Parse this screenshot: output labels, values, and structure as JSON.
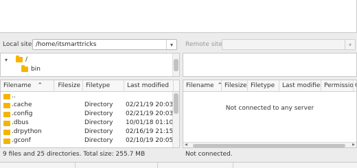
{
  "local": {
    "site_label": "Local site:",
    "path": "/home/itsmarttricks",
    "tree": [
      {
        "toggle": "▾",
        "label": "/"
      },
      {
        "toggle": "",
        "label": "bin"
      }
    ],
    "columns": [
      "Filename",
      "Filesize",
      "Filetype",
      "Last modified"
    ],
    "sort_indicator": "⌃",
    "rows": [
      {
        "name": "..",
        "type": "",
        "modified": ""
      },
      {
        "name": ".cache",
        "type": "Directory",
        "modified": "02/21/19 20:03..."
      },
      {
        "name": ".config",
        "type": "Directory",
        "modified": "02/21/19 20:03..."
      },
      {
        "name": ".dbus",
        "type": "Directory",
        "modified": "10/01/18 01:10..."
      },
      {
        "name": ".drpython",
        "type": "Directory",
        "modified": "02/16/19 21:15..."
      },
      {
        "name": ".gconf",
        "type": "Directory",
        "modified": "02/10/19 20:05..."
      }
    ],
    "status": "9 files and 25 directories. Total size: 255.7 MB"
  },
  "remote": {
    "site_label": "Remote site:",
    "path": "",
    "columns": [
      "Filename",
      "Filesize",
      "Filetype",
      "Last modified",
      "Permission",
      "O"
    ],
    "sort_indicator": "⌃",
    "empty_message": "Not connected to any server",
    "status": "Not connected."
  },
  "icons": {
    "dropdown": "▾",
    "folder": "folder-icon",
    "scroll_left": "◂",
    "scroll_right": "▸"
  },
  "colors": {
    "folder": "#f5b400",
    "background": "#ececec"
  }
}
